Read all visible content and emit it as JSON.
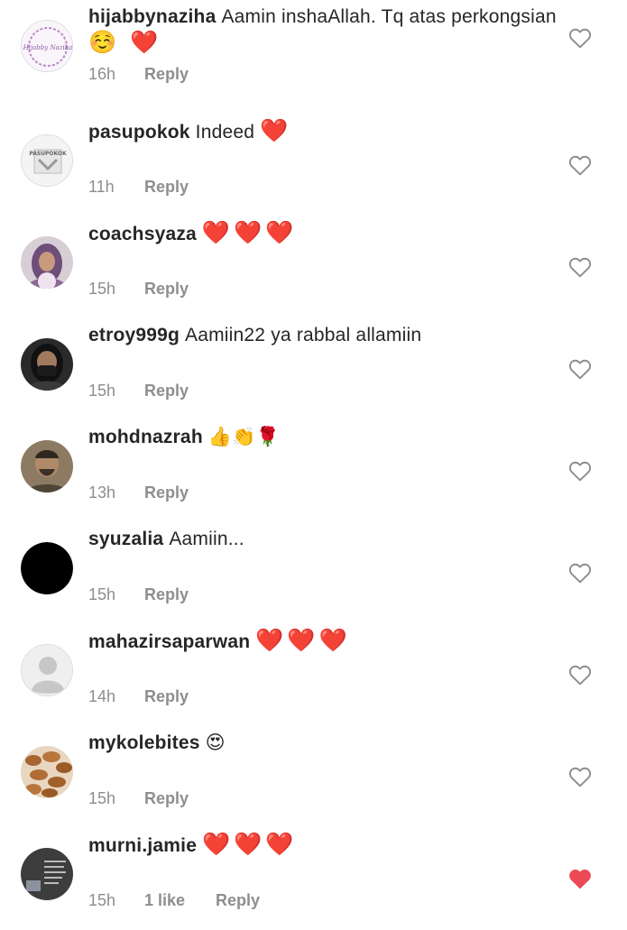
{
  "colors": {
    "text": "#262626",
    "meta": "#8e8e8e",
    "heart_filled": "#ed4956",
    "heart_outline": "#8e8e8e"
  },
  "comments": [
    {
      "username": "hijabbynaziha",
      "text": "Aamin inshaAllah. Tq atas perkongsian",
      "emoji": "☺️ ❤️",
      "time": "16h",
      "likes": "",
      "reply_label": "Reply",
      "avatar": "hijabbynaziha-logo-avatar",
      "liked": false,
      "avatar_text": "Hijabby Naziha"
    },
    {
      "username": "pasupokok",
      "text": "Indeed",
      "emoji": "❤️",
      "time": "11h",
      "likes": "",
      "reply_label": "Reply",
      "avatar": "pasupokok-logo-avatar",
      "liked": false,
      "avatar_text": "PASUPOKOK"
    },
    {
      "username": "coachsyaza",
      "text": "",
      "emoji": "❤️❤️❤️",
      "time": "15h",
      "likes": "",
      "reply_label": "Reply",
      "avatar": "person-hijab-avatar",
      "liked": false
    },
    {
      "username": "etroy999g",
      "text": "Aamiin22 ya rabbal allamiin",
      "emoji": "",
      "time": "15h",
      "likes": "",
      "reply_label": "Reply",
      "avatar": "person-mask-avatar",
      "liked": false
    },
    {
      "username": "mohdnazrah",
      "text": "",
      "emoji": "👍👏🌹",
      "time": "13h",
      "likes": "",
      "reply_label": "Reply",
      "avatar": "person-photo-avatar",
      "liked": false
    },
    {
      "username": "syuzalia",
      "text": "Aamiin...",
      "emoji": "",
      "time": "15h",
      "likes": "",
      "reply_label": "Reply",
      "avatar": "black-avatar",
      "liked": false
    },
    {
      "username": "mahazirsaparwan",
      "text": "",
      "emoji": "❤️❤️❤️",
      "time": "14h",
      "likes": "",
      "reply_label": "Reply",
      "avatar": "default-profile-avatar",
      "liked": false
    },
    {
      "username": "mykolebites",
      "text": "",
      "emoji": "😍",
      "time": "15h",
      "likes": "",
      "reply_label": "Reply",
      "avatar": "food-photo-avatar",
      "liked": false
    },
    {
      "username": "murni.jamie",
      "text": "",
      "emoji": "❤️❤️❤️",
      "time": "15h",
      "likes": "1 like",
      "reply_label": "Reply",
      "avatar": "text-quote-avatar",
      "liked": true
    }
  ]
}
